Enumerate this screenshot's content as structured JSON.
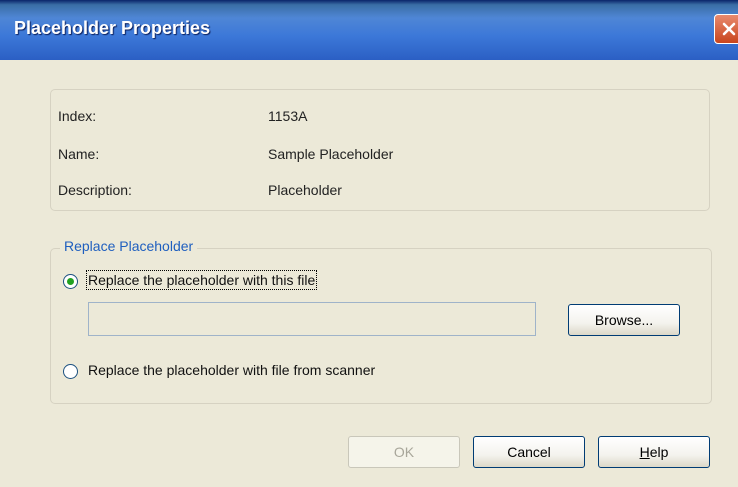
{
  "window": {
    "title": "Placeholder Properties"
  },
  "info": {
    "index_label": "Index:",
    "index_value": "1153A",
    "name_label": "Name:",
    "name_value": "Sample Placeholder",
    "description_label": "Description:",
    "description_value": "Placeholder"
  },
  "replace_group": {
    "legend": "Replace Placeholder",
    "option_file_label": "Replace the placeholder with this file",
    "option_file_selected": true,
    "file_path_value": "",
    "browse_label": "Browse...",
    "option_scanner_label": "Replace the placeholder with file from scanner",
    "option_scanner_selected": false
  },
  "buttons": {
    "ok_label": "OK",
    "ok_enabled": false,
    "cancel_label": "Cancel",
    "help_label": "Help",
    "help_mnemonic": "H"
  },
  "colors": {
    "titlebar": "#3c78d8",
    "dialog_bg": "#ece9d8",
    "legend_text": "#1f5fbf",
    "radio_selected": "#21a121"
  },
  "icons": {
    "close": "close-icon"
  }
}
